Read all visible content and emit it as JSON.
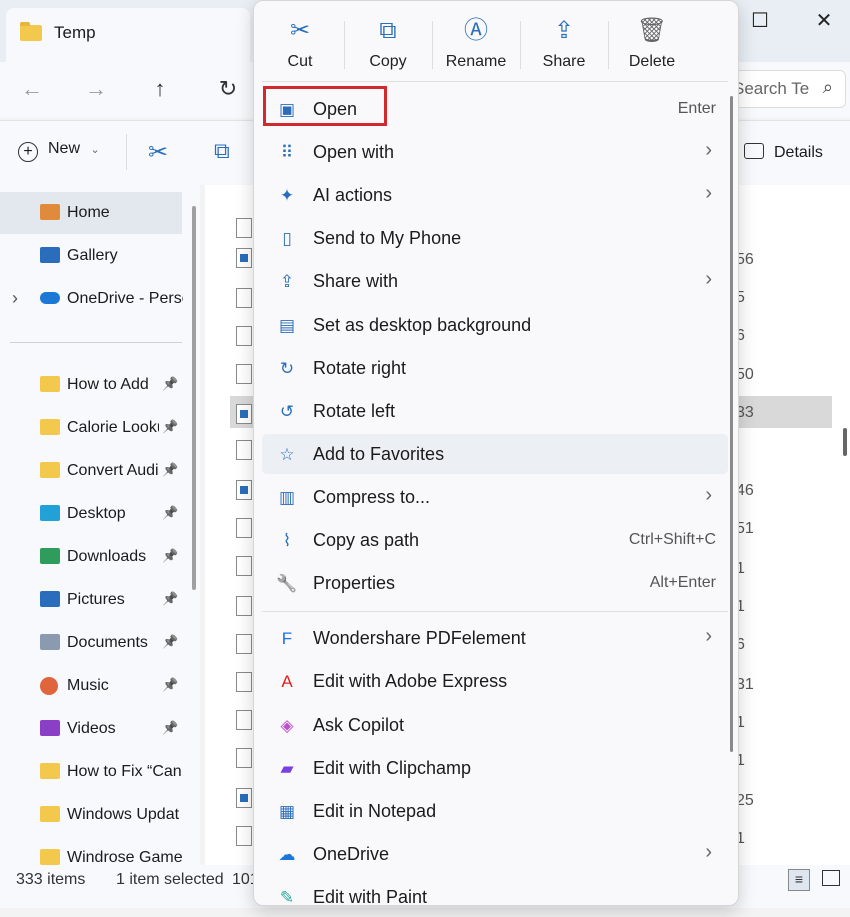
{
  "window": {
    "tab_title": "Temp",
    "search_placeholder": "Search Te",
    "minimize": "—",
    "maximize": "☐",
    "close": "✕"
  },
  "toolbar": {
    "new_label": "New",
    "details_label": "Details"
  },
  "sidebar": {
    "items": [
      {
        "label": "Home",
        "icon": "home-icon"
      },
      {
        "label": "Gallery",
        "icon": "gallery-icon"
      },
      {
        "label": "OneDrive - Perso",
        "icon": "onedrive-icon"
      },
      {
        "label": "How to Add",
        "icon": "folder-icon"
      },
      {
        "label": "Calorie Looku",
        "icon": "folder-icon"
      },
      {
        "label": "Convert Audi",
        "icon": "folder-icon"
      },
      {
        "label": "Desktop",
        "icon": "desktop-icon"
      },
      {
        "label": "Downloads",
        "icon": "downloads-icon"
      },
      {
        "label": "Pictures",
        "icon": "pictures-icon"
      },
      {
        "label": "Documents",
        "icon": "documents-icon"
      },
      {
        "label": "Music",
        "icon": "music-icon"
      },
      {
        "label": "Videos",
        "icon": "videos-icon"
      },
      {
        "label": "How to Fix “Can",
        "icon": "folder-icon"
      },
      {
        "label": "Windows Updat",
        "icon": "folder-icon"
      },
      {
        "label": "Windrose Game",
        "icon": "folder-icon"
      }
    ]
  },
  "filelist": {
    "numbers": [
      "56",
      "5",
      "6",
      "50",
      "33",
      "46",
      "51",
      "1",
      "1",
      "6",
      "31",
      "1",
      "1",
      "25",
      "1"
    ]
  },
  "status": {
    "count": "333 items",
    "selected": "1 item selected",
    "size": "101"
  },
  "context_menu": {
    "quick_actions": [
      {
        "label": "Cut",
        "icon": "scissors-icon"
      },
      {
        "label": "Copy",
        "icon": "copy-icon"
      },
      {
        "label": "Rename",
        "icon": "rename-icon"
      },
      {
        "label": "Share",
        "icon": "share-icon"
      },
      {
        "label": "Delete",
        "icon": "trash-icon"
      }
    ],
    "items": [
      {
        "label": "Open",
        "shortcut": "Enter",
        "icon": "image-icon"
      },
      {
        "label": "Open with",
        "icon": "open-with-icon",
        "submenu": true
      },
      {
        "label": "AI actions",
        "icon": "sparkle-icon",
        "submenu": true
      },
      {
        "label": "Send to My Phone",
        "icon": "phone-icon"
      },
      {
        "label": "Share with",
        "icon": "share-icon",
        "submenu": true
      },
      {
        "label": "Set as desktop background",
        "icon": "wallpaper-icon"
      },
      {
        "label": "Rotate right",
        "icon": "rotate-right-icon"
      },
      {
        "label": "Rotate left",
        "icon": "rotate-left-icon"
      },
      {
        "label": "Add to Favorites",
        "icon": "star-icon"
      },
      {
        "label": "Compress to...",
        "icon": "zip-icon",
        "submenu": true
      },
      {
        "label": "Copy as path",
        "shortcut": "Ctrl+Shift+C",
        "icon": "path-icon"
      },
      {
        "label": "Properties",
        "shortcut": "Alt+Enter",
        "icon": "wrench-icon"
      },
      {
        "label": "Wondershare PDFelement",
        "icon": "pdfelement-icon",
        "submenu": true
      },
      {
        "label": "Edit with Adobe Express",
        "icon": "adobe-icon"
      },
      {
        "label": "Ask Copilot",
        "icon": "copilot-icon"
      },
      {
        "label": "Edit with Clipchamp",
        "icon": "clipchamp-icon"
      },
      {
        "label": "Edit in Notepad",
        "icon": "notepad-icon"
      },
      {
        "label": "OneDrive",
        "icon": "onedrive-icon",
        "submenu": true
      },
      {
        "label": "Edit with Paint",
        "icon": "paint-icon"
      }
    ]
  }
}
